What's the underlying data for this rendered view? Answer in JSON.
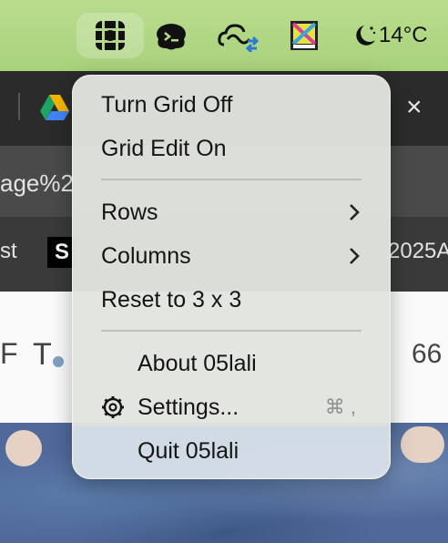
{
  "menubar": {
    "icons": [
      "grid-app-icon",
      "terminal-icon",
      "creative-cloud-sync-icon",
      "nikon-app-icon",
      "moon-weather-icon"
    ],
    "weather": {
      "temperature": "14°C"
    }
  },
  "browser": {
    "url_fragment": "age%2",
    "bookmark_left": "st",
    "bookmark_badge": "S",
    "bookmark_right": "2025A",
    "toolbar_left": "F",
    "toolbar_tool": "T",
    "toolbar_right": "66"
  },
  "menu": {
    "items": [
      {
        "label": "Turn Grid Off"
      },
      {
        "label": "Grid Edit On"
      },
      {
        "label": "Rows"
      },
      {
        "label": "Columns"
      },
      {
        "label": "Reset to 3 x 3"
      },
      {
        "label": "About 05lali"
      },
      {
        "label": "Settings..."
      },
      {
        "label": "Quit 05lali"
      }
    ],
    "settings_shortcut": "⌘ ,"
  }
}
